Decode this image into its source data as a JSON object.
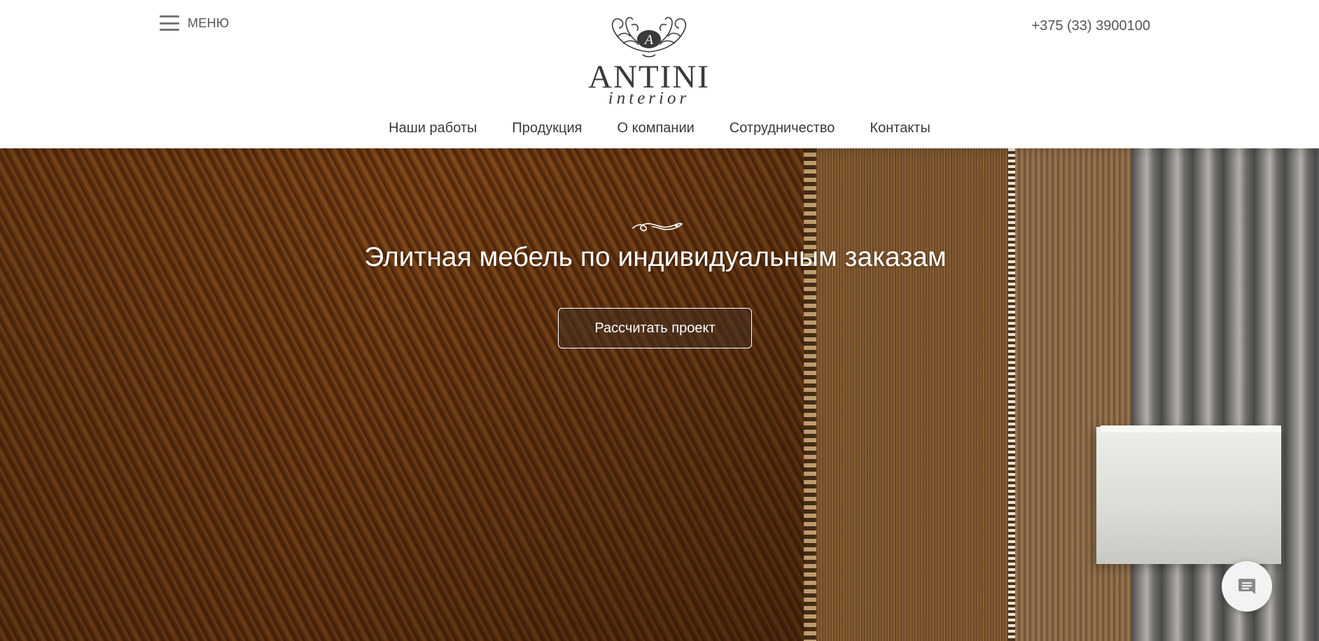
{
  "header": {
    "menu_label": "МЕНЮ",
    "phone": "+375 (33) 3900100",
    "logo": {
      "name": "ANTINI",
      "subtitle": "interior",
      "monogram": "A"
    }
  },
  "nav": {
    "items": [
      {
        "label": "Наши работы"
      },
      {
        "label": "Продукция"
      },
      {
        "label": "О компании"
      },
      {
        "label": "Сотрудничество"
      },
      {
        "label": "Контакты"
      }
    ]
  },
  "hero": {
    "title": "Элитная мебель по индивидуальным заказам",
    "cta_label": "Рассчитать проект"
  },
  "icons": {
    "menu": "hamburger-menu-icon",
    "flourish": "flourish-ornament-icon",
    "chat": "chat-message-icon"
  },
  "colors": {
    "text_dark": "#3a3a3a",
    "text_muted": "#555555",
    "header_bg": "#ffffff",
    "hero_text": "#ffffff"
  }
}
